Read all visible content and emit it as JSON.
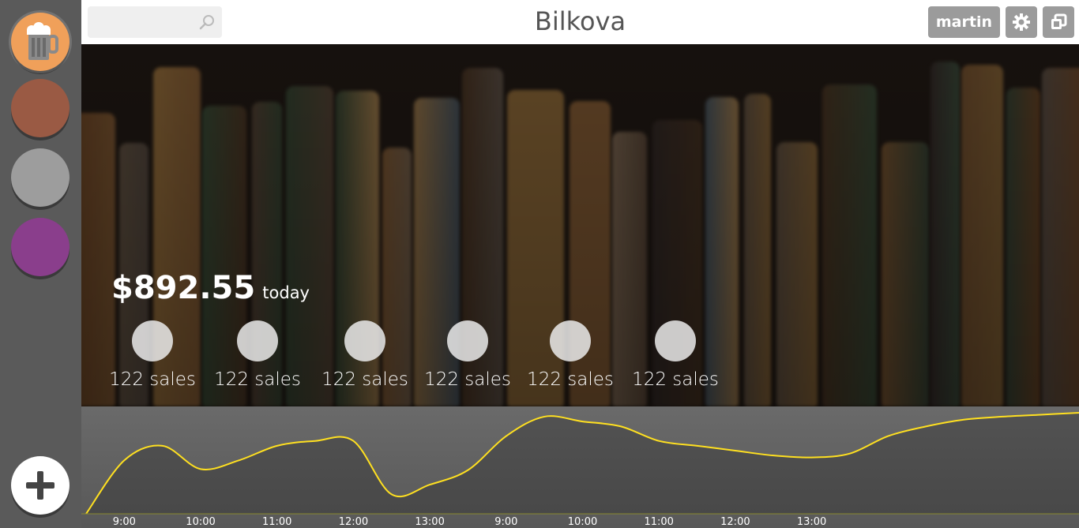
{
  "sidebar": {
    "venues": [
      {
        "icon": "beer-mug-icon",
        "color": "#f0a05a",
        "active": true
      },
      {
        "icon": "venue-dot",
        "color": "#9a5a44",
        "active": false
      },
      {
        "icon": "venue-dot",
        "color": "#9d9d9d",
        "active": false
      },
      {
        "icon": "venue-dot",
        "color": "#8a3e8c",
        "active": false
      }
    ],
    "add_icon": "plus-icon"
  },
  "header": {
    "search_placeholder": "",
    "title": "Bilkova",
    "user_label": "martin",
    "settings_icon": "gear-icon",
    "window_icon": "restore-window-icon"
  },
  "summary": {
    "amount": "$892.55",
    "period": "today"
  },
  "stats": [
    {
      "label": "122 sales"
    },
    {
      "label": "122 sales"
    },
    {
      "label": "122 sales"
    },
    {
      "label": "122 sales"
    },
    {
      "label": "122 sales"
    },
    {
      "label": "122 sales"
    }
  ],
  "chart_data": {
    "type": "line",
    "color": "#ffe020",
    "x": [
      "",
      "9:00",
      "",
      "10:00",
      "",
      "11:00",
      "",
      "12:00",
      "",
      "13:00",
      "",
      "9:00",
      "",
      "10:00",
      "",
      "11:00",
      "",
      "12:00",
      "",
      "13:00",
      "",
      "",
      "",
      "",
      "",
      "",
      ""
    ],
    "values": [
      0,
      55,
      70,
      46,
      55,
      70,
      75,
      75,
      20,
      30,
      45,
      80,
      100,
      95,
      90,
      75,
      70,
      65,
      60,
      58,
      62,
      80,
      90,
      97,
      100,
      102,
      104
    ],
    "tick_labels": [
      "9:00",
      "10:00",
      "11:00",
      "12:00",
      "13:00",
      "9:00",
      "10:00",
      "11:00",
      "12:00",
      "13:00"
    ],
    "grid": false
  }
}
